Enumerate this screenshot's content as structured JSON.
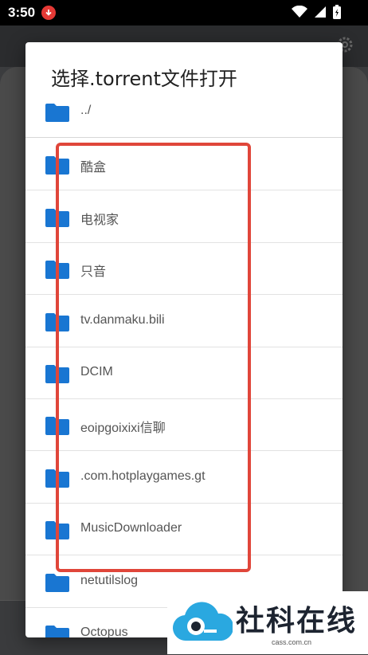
{
  "status_bar": {
    "time": "3:50",
    "icons": [
      "app-notification-icon",
      "wifi-icon",
      "signal-icon",
      "battery-icon"
    ]
  },
  "dialog": {
    "title": "选择.torrent文件打开",
    "items": [
      {
        "label": "../",
        "icon": "folder-icon"
      },
      {
        "label": "酷盒",
        "icon": "folder-icon"
      },
      {
        "label": "电视家",
        "icon": "folder-icon"
      },
      {
        "label": "只音",
        "icon": "folder-icon"
      },
      {
        "label": "tv.danmaku.bili",
        "icon": "folder-icon"
      },
      {
        "label": "DCIM",
        "icon": "folder-icon"
      },
      {
        "label": "eoipgoixixi信聊",
        "icon": "folder-icon"
      },
      {
        "label": ".com.hotplaygames.gt",
        "icon": "folder-icon"
      },
      {
        "label": "MusicDownloader",
        "icon": "folder-icon"
      },
      {
        "label": "netutilslog",
        "icon": "folder-icon"
      },
      {
        "label": "Octopus",
        "icon": "folder-icon"
      }
    ]
  },
  "watermark": {
    "text": "社科在线",
    "subtext": "cass.com.cn"
  },
  "colors": {
    "folder": "#1976d2",
    "highlight": "#e0463a",
    "dialog_bg": "#ffffff"
  }
}
